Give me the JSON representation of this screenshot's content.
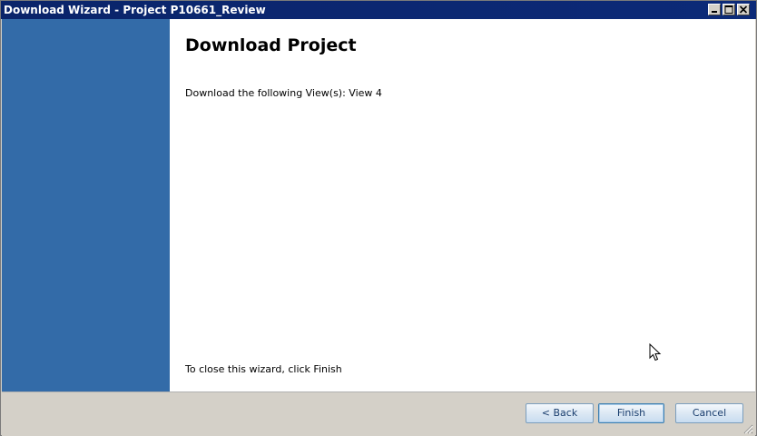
{
  "window": {
    "title": "Download Wizard - Project P10661_Review"
  },
  "main": {
    "title": "Download Project",
    "description": "Download the following View(s): View 4",
    "close_hint": "To close this wizard, click Finish"
  },
  "buttons": {
    "back": "< Back",
    "finish": "Finish",
    "cancel": "Cancel"
  },
  "colors": {
    "titlebar": "#0a246a",
    "sidebar": "#336ba8",
    "footer": "#d4d0c8"
  },
  "icons": {
    "minimize": "minimize-icon",
    "maximize": "maximize-icon",
    "close": "close-icon",
    "cursor": "mouse-pointer-icon",
    "grip": "resize-grip-icon"
  }
}
